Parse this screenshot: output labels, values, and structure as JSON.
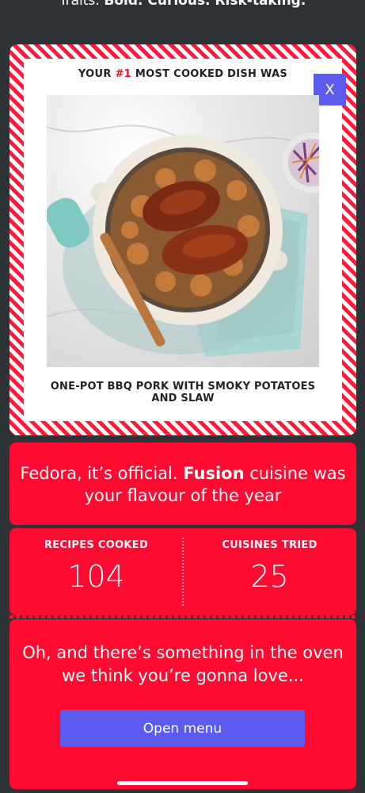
{
  "header": {
    "traits_prefix": "Traits: ",
    "traits_value": "Bold. Curious. Risk-taking."
  },
  "dish_card": {
    "title_pre": "YOUR ",
    "title_rank": "#1",
    "title_post": " MOST COOKED DISH WAS",
    "close_label": "X",
    "dish_name": "ONE-POT BBQ PORK WITH SMOKY POTATOES AND SLAW"
  },
  "cuisine": {
    "line_pre": "Fedora, it’s official. ",
    "cuisine_name": "Fusion",
    "line_post": " cuisine was your flavour of the year"
  },
  "stats": [
    {
      "label": "RECIPES COOKED",
      "value": "104"
    },
    {
      "label": "CUISINES TRIED",
      "value": "25"
    }
  ],
  "promo": {
    "text": "Oh, and there’s something in the oven we think you’re gonna love...",
    "button_label": "Open menu"
  },
  "colors": {
    "background": "#2e3338",
    "accent_red": "#ff0a30",
    "button_blue": "#5b5bf0"
  }
}
